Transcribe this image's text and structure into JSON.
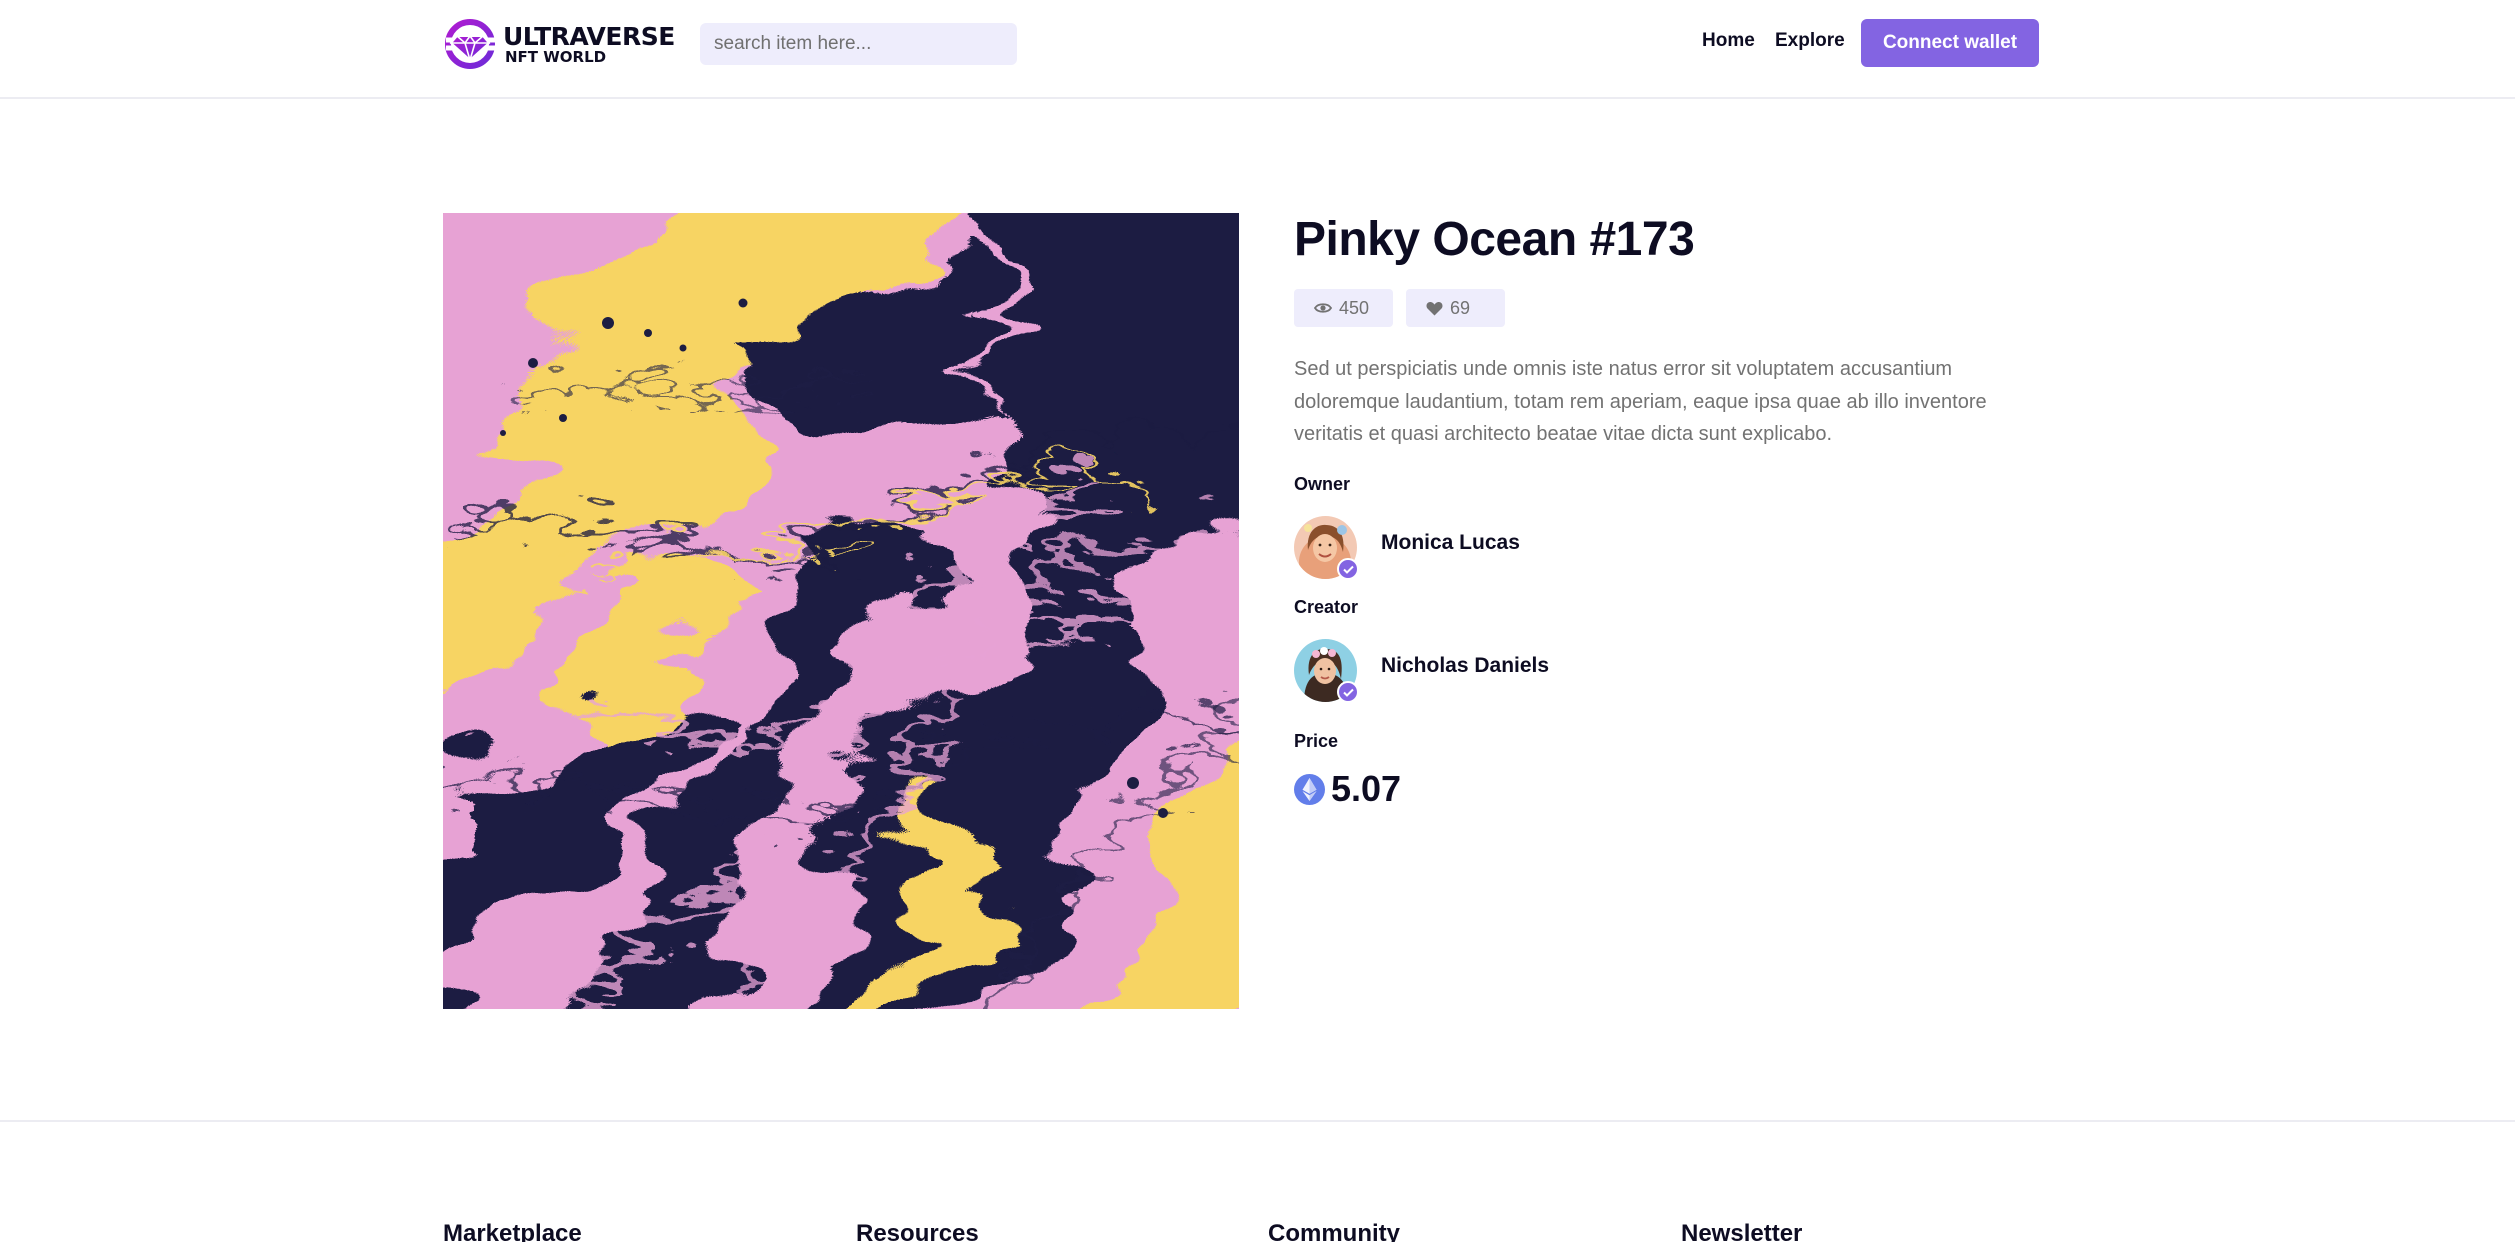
{
  "header": {
    "logo_title": "ULTRAVERSE",
    "logo_subtitle": "NFT WORLD",
    "search_placeholder": "search item here...",
    "nav_home": "Home",
    "nav_explore": "Explore",
    "connect_label": "Connect wallet"
  },
  "item": {
    "title": "Pinky Ocean #173",
    "views": "450",
    "likes": "69",
    "description": "Sed ut perspiciatis unde omnis iste natus error sit voluptatem accusantium doloremque laudantium, totam rem aperiam, eaque ipsa quae ab illo inventore veritatis et quasi architecto beatae vitae dicta sunt explicabo.",
    "owner_label": "Owner",
    "owner_name": "Monica Lucas",
    "creator_label": "Creator",
    "creator_name": "Nicholas Daniels",
    "price_label": "Price",
    "price_value": "5.07",
    "currency_icon": "ethereum-icon"
  },
  "footer": {
    "columns": [
      "Marketplace",
      "Resources",
      "Community",
      "Newsletter"
    ]
  },
  "colors": {
    "accent": "#8364e2",
    "chip_bg": "#eeedfc",
    "text_dark": "#0d0c22",
    "text_muted": "#727272"
  }
}
